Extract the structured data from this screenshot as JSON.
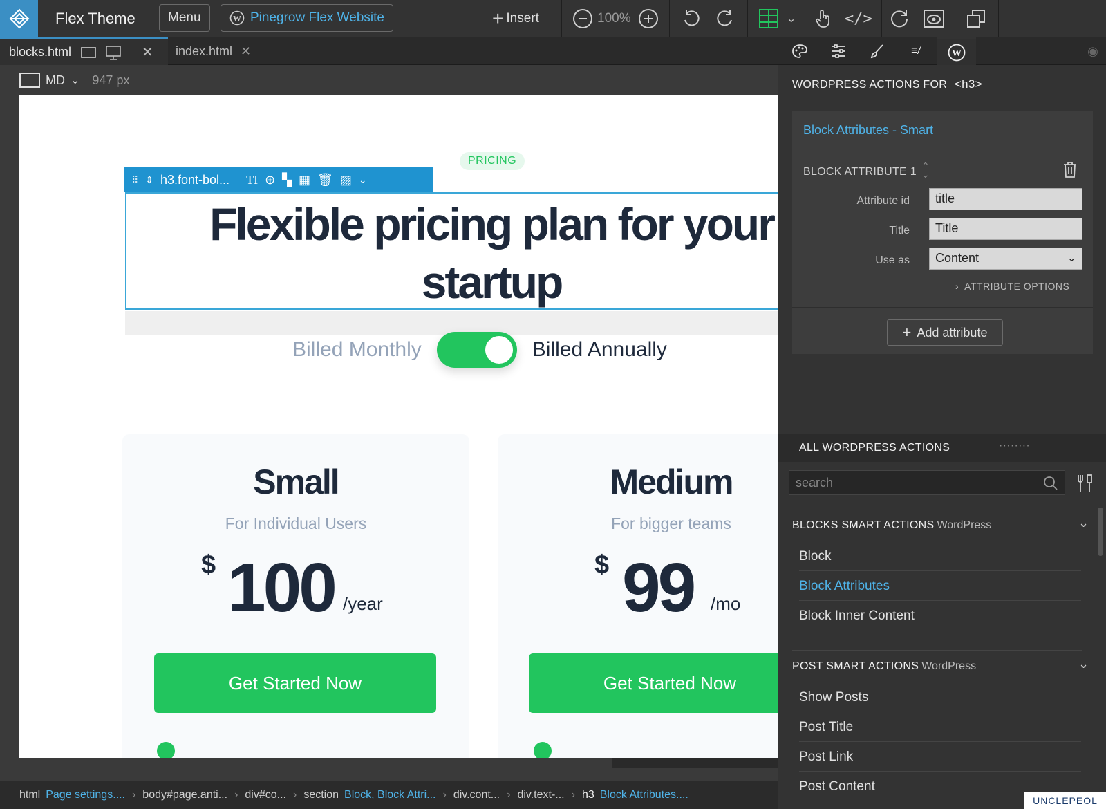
{
  "app": {
    "title": "Flex Theme",
    "menu_label": "Menu",
    "site_label": "Pinegrow Flex Website",
    "insert_label": "Insert",
    "zoom": "100%"
  },
  "tabs": [
    {
      "label": "blocks.html"
    },
    {
      "label": "index.html"
    }
  ],
  "viewport": {
    "size": "MD",
    "width": "947 px"
  },
  "page": {
    "pill": "PRICING",
    "selection_label": "h3.font-bol...",
    "headline_line1": "Flexible pricing plan for your",
    "headline_line2": "startup",
    "billed_monthly": "Billed Monthly",
    "billed_annually": "Billed Annually",
    "toggle_annual_on": true,
    "cards": [
      {
        "title": "Small",
        "subtitle": "For Individual Users",
        "currency": "$",
        "amount": "100",
        "period": "/year",
        "cta": "Get Started Now"
      },
      {
        "title": "Medium",
        "subtitle": "For bigger teams",
        "currency": "$",
        "amount": "99",
        "period": "/mo",
        "cta": "Get Started Now"
      }
    ]
  },
  "panel": {
    "heading": "WORDPRESS ACTIONS FOR",
    "element": "<h3>",
    "block_link": "Block Attributes - Smart",
    "attr_header": "BLOCK ATTRIBUTE 1",
    "attr_id_label": "Attribute id",
    "attr_id_value": "title",
    "title_label": "Title",
    "title_value": "Title",
    "use_as_label": "Use as",
    "use_as_value": "Content",
    "attr_options": "ATTRIBUTE OPTIONS",
    "add_attribute": "Add attribute",
    "all_heading": "ALL WORDPRESS ACTIONS",
    "search_placeholder": "search",
    "sections": [
      {
        "title": "BLOCKS SMART ACTIONS",
        "sub": "WordPress",
        "items": [
          "Block",
          "Block Attributes",
          "Block Inner Content"
        ]
      },
      {
        "title": "POST SMART ACTIONS",
        "sub": "WordPress",
        "items": [
          "Show Posts",
          "Post Title",
          "Post Link",
          "Post Content"
        ]
      }
    ]
  },
  "breadcrumb": {
    "c1": "html",
    "c1b": "Page settings....",
    "c2": "body#page.anti...",
    "c3": "div#co...",
    "c4": "section",
    "c4b": "Block, Block Attri...",
    "c5": "div.cont...",
    "c6": "div.text-...",
    "c7": "h3",
    "c7b": "Block Attributes...."
  },
  "watermark": "UNCLEPEOL",
  "colors": {
    "accent_blue": "#3b8fc4",
    "link_blue": "#4fb3e8",
    "green": "#22c55e",
    "dark_text": "#1e293b"
  }
}
